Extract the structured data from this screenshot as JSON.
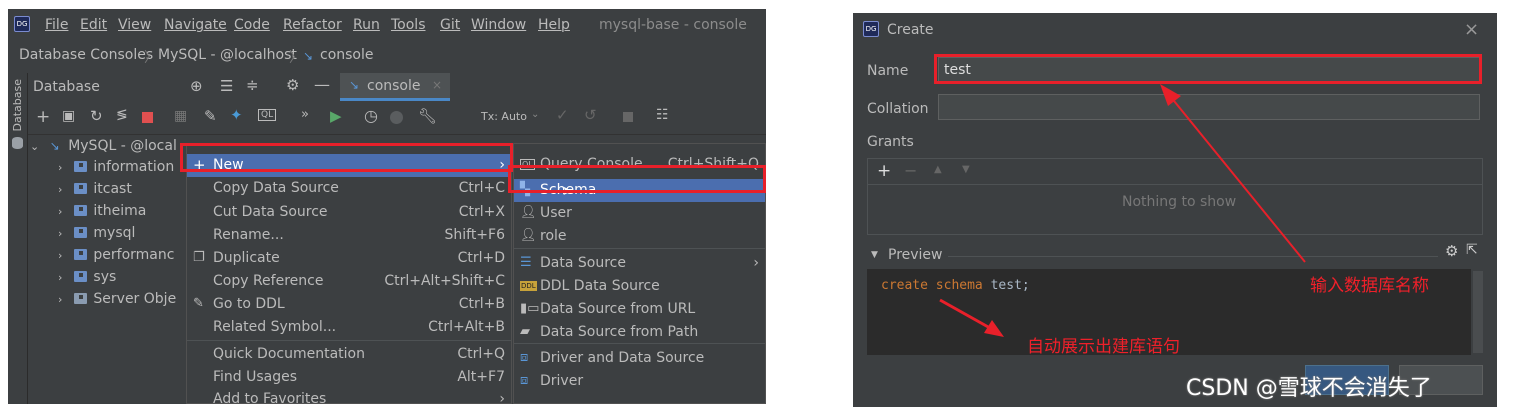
{
  "ide": {
    "menubar": [
      "File",
      "Edit",
      "View",
      "Navigate",
      "Code",
      "Refactor",
      "Run",
      "Tools",
      "Git",
      "Window",
      "Help"
    ],
    "window_title": "mysql-base - console",
    "breadcrumb": [
      "Database Consoles",
      "MySQL - @localhost",
      "console"
    ],
    "db_panel_title": "Database",
    "side_strip_label": "Database",
    "console_tab": "console",
    "tx_mode": "Tx: Auto",
    "tree": {
      "root": "MySQL - @local",
      "items": [
        "information",
        "itcast",
        "itheima",
        "mysql",
        "performanc",
        "sys",
        "Server Obje"
      ]
    },
    "context_menu": [
      {
        "label": "New",
        "shortcut": "",
        "icon": "+",
        "submenu": true
      },
      {
        "label": "Copy Data Source",
        "shortcut": "Ctrl+C"
      },
      {
        "label": "Cut Data Source",
        "shortcut": "Ctrl+X"
      },
      {
        "label": "Rename...",
        "shortcut": "Shift+F6"
      },
      {
        "label": "Duplicate",
        "shortcut": "Ctrl+D",
        "icon": "duplicate-icon"
      },
      {
        "label": "Copy Reference",
        "shortcut": "Ctrl+Alt+Shift+C"
      },
      {
        "label": "Go to DDL",
        "shortcut": "Ctrl+B",
        "icon": "edit-icon"
      },
      {
        "label": "Related Symbol...",
        "shortcut": "Ctrl+Alt+B"
      },
      {
        "label": "Quick Documentation",
        "shortcut": "Ctrl+Q"
      },
      {
        "label": "Find Usages",
        "shortcut": "Alt+F7"
      },
      {
        "label": "Add to Favorites",
        "shortcut": "",
        "submenu": true
      }
    ],
    "submenu": [
      {
        "label": "Query Console",
        "shortcut": "Ctrl+Shift+Q",
        "icon": "QL"
      },
      {
        "label": "Schema",
        "shortcut": ""
      },
      {
        "label": "User",
        "shortcut": ""
      },
      {
        "label": "role",
        "shortcut": ""
      },
      {
        "label": "Data Source",
        "shortcut": "",
        "submenu": true
      },
      {
        "label": "DDL Data Source",
        "shortcut": "",
        "icon": "DDL"
      },
      {
        "label": "Data Source from URL",
        "shortcut": ""
      },
      {
        "label": "Data Source from Path",
        "shortcut": ""
      },
      {
        "label": "Driver and Data Source",
        "shortcut": ""
      },
      {
        "label": "Driver",
        "shortcut": ""
      }
    ]
  },
  "dialog": {
    "title": "Create",
    "name_label": "Name",
    "name_value": "test",
    "collation_label": "Collation",
    "collation_value": "",
    "grants_label": "Grants",
    "grants_empty": "Nothing to show",
    "preview_label": "Preview",
    "code_keyword1": "create",
    "code_keyword2": "schema",
    "code_rest": "test;"
  },
  "annotations": {
    "name_hint": "输入数据库名称",
    "preview_hint": "自动展示出建库语句"
  },
  "watermark": "CSDN @雪球不会消失了",
  "colors": {
    "accent": "#4b6eaf",
    "annotation": "#e8202a",
    "keyword": "#cc7832"
  }
}
